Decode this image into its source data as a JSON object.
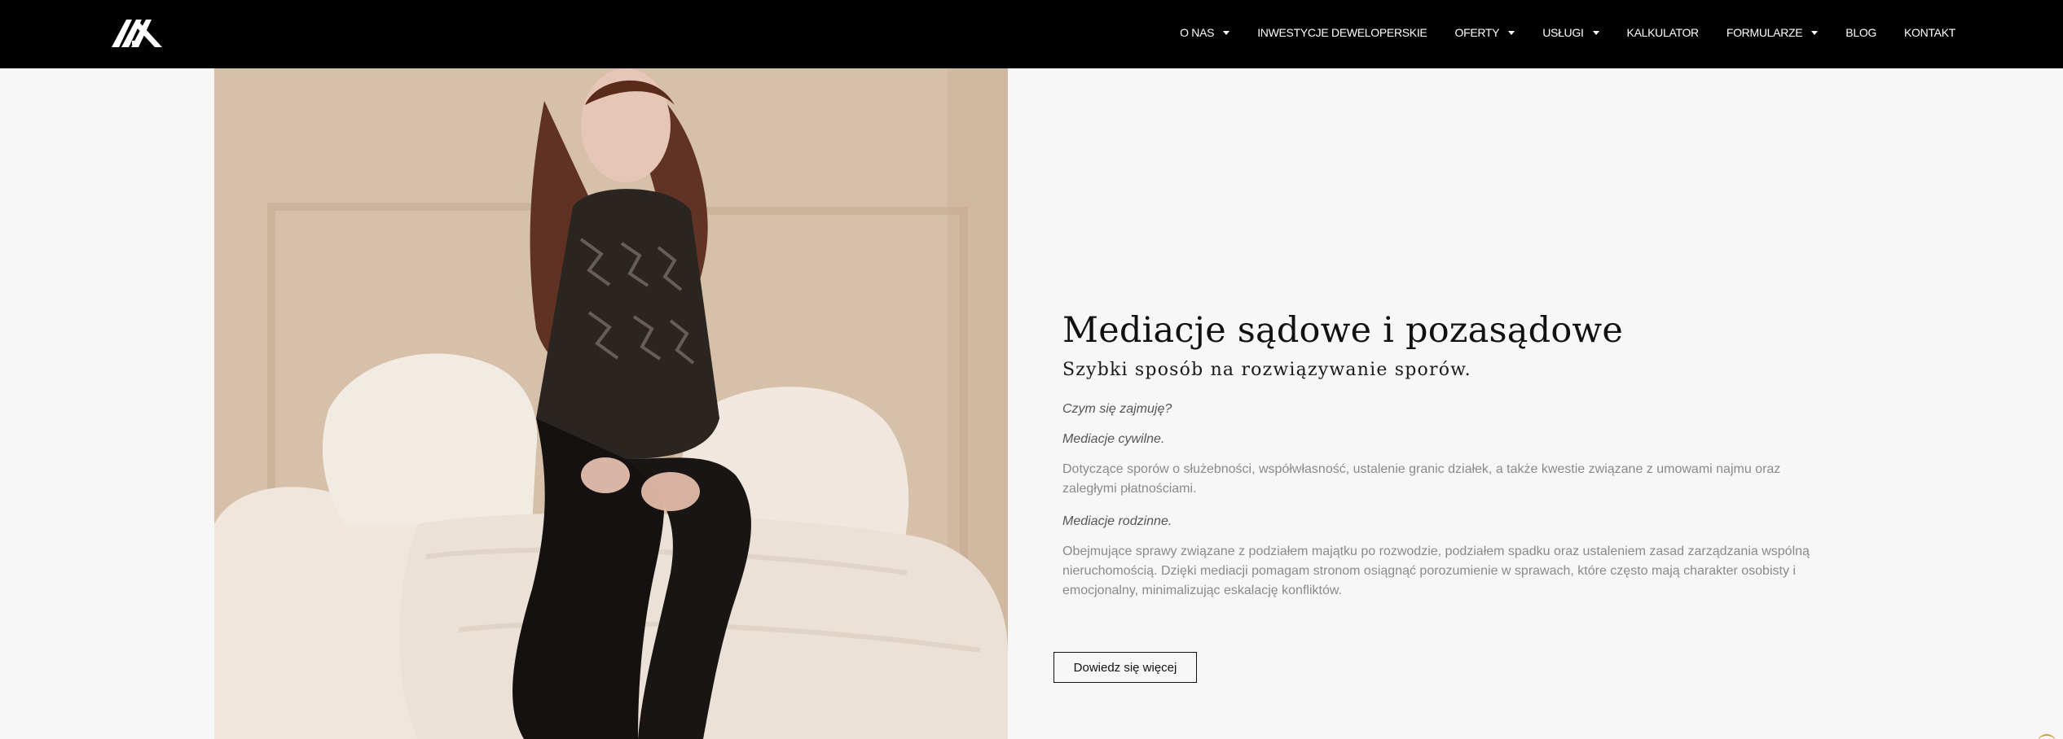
{
  "header": {
    "logo_icon": "stylized-house-logo",
    "nav": [
      {
        "label": "O NAS",
        "has_dropdown": true
      },
      {
        "label": "INWESTYCJE DEWELOPERSKIE",
        "has_dropdown": false
      },
      {
        "label": "OFERTY",
        "has_dropdown": true
      },
      {
        "label": "USŁUGI",
        "has_dropdown": true
      },
      {
        "label": "KALKULATOR",
        "has_dropdown": false
      },
      {
        "label": "FORMULARZE",
        "has_dropdown": true
      },
      {
        "label": "BLOG",
        "has_dropdown": false
      },
      {
        "label": "KONTAKT",
        "has_dropdown": false
      }
    ]
  },
  "main": {
    "photo_icon": "woman-on-sofa-photo",
    "title": "Mediacje sądowe i pozasądowe",
    "subtitle": "Szybki sposób na rozwiązywanie sporów.",
    "section_label": "Czym się zajmuję?",
    "civil": {
      "label": "Mediacje cywilne.",
      "text": "Dotyczące sporów o służebności, współwłasność, ustalenie granic działek, a także kwestie związane z umowami najmu oraz zaległymi płatnościami."
    },
    "family": {
      "label": "Mediacje rodzinne.",
      "text": "Obejmujące sprawy związane z podziałem majątku po rozwodzie, podziałem spadku oraz ustaleniem zasad zarządzania wspólną nieruchomością. Dzięki mediacji pomagam stronom osiągnąć porozumienie w sprawach, które często mają charakter osobisty i emocjonalny, minimalizując eskalację konfliktów."
    },
    "cta_label": "Dowiedz się więcej"
  },
  "colors": {
    "header_bg": "#000000",
    "page_bg": "#f7f7f7",
    "title": "#111111",
    "body_text": "#8a8a8a",
    "accent": "#d29a3b"
  }
}
